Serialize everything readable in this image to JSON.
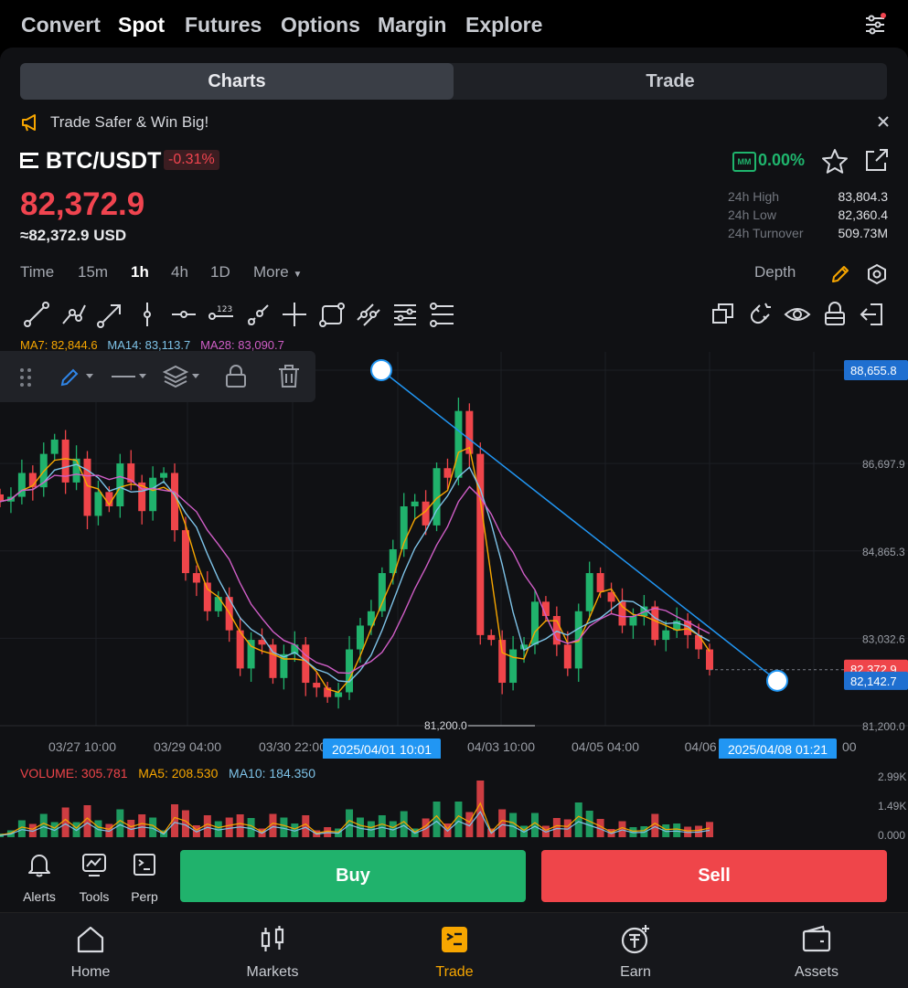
{
  "top_nav": [
    "Convert",
    "Spot",
    "Futures",
    "Options",
    "Margin",
    "Explore"
  ],
  "top_nav_active": "Spot",
  "segment": {
    "charts": "Charts",
    "trade": "Trade"
  },
  "promo": {
    "text": "Trade Safer & Win Big!"
  },
  "pair": {
    "symbol": "BTC/USDT",
    "change": "-0.31%",
    "price": "82,372.9",
    "usd": "≈82,372.9 USD"
  },
  "mm": {
    "badge": "MM",
    "value": "0.00%"
  },
  "stats": [
    {
      "label": "24h High",
      "value": "83,804.3"
    },
    {
      "label": "24h Low",
      "value": "82,360.4"
    },
    {
      "label": "24h Turnover",
      "value": "509.73M"
    }
  ],
  "timeframes": {
    "time": "Time",
    "m15": "15m",
    "h1": "1h",
    "h4": "4h",
    "d1": "1D",
    "more": "More",
    "depth": "Depth"
  },
  "ma_legend": {
    "ma7": "MA7: 82,844.6",
    "ma14": "MA14: 83,113.7",
    "ma28": "MA28: 83,090.7"
  },
  "colors": {
    "ma7": "#f7a600",
    "ma14": "#7ec3e8",
    "ma28": "#d05ec7",
    "up": "#20b26c",
    "down": "#ef454a",
    "accent": "#2196f3"
  },
  "chart_data": {
    "type": "candlestick",
    "pair": "BTC/USDT",
    "interval": "1h",
    "y_ticks": [
      "88,655.8",
      "86,697.9",
      "84,865.3",
      "83,032.6",
      "81,200.0"
    ],
    "ylim": [
      81200.0,
      88655.8
    ],
    "x_ticks": [
      "03/27 10:00",
      "03/29 04:00",
      "03/30 22:00",
      "04/03 10:00",
      "04/05 04:00",
      "04/06 2"
    ],
    "x_ticks_tail": "00",
    "last_price_tag": "82,372.9",
    "trendline_end_tag": "82,142.7",
    "low_marker": "81,200.0",
    "crosshair_x_labels": [
      "2025/04/01 10:01",
      "2025/04/08 01:21"
    ],
    "closes": [
      85900,
      86000,
      86500,
      86200,
      86900,
      87200,
      86300,
      86800,
      85600,
      86100,
      85800,
      86700,
      86300,
      85700,
      86400,
      86500,
      85300,
      84400,
      84200,
      83600,
      83900,
      83200,
      82400,
      83000,
      82900,
      82200,
      82700,
      82900,
      82100,
      82000,
      81800,
      81900,
      82800,
      83300,
      83600,
      84400,
      84900,
      85800,
      85900,
      85400,
      86600,
      86400,
      87800,
      86900,
      83100,
      83000,
      82100,
      82800,
      82900,
      83800,
      83500,
      82900,
      82400,
      83600,
      84400,
      84000,
      83800,
      83300,
      83500,
      83700,
      83000,
      83200,
      83400,
      83100,
      82800,
      82373
    ],
    "volume": {
      "label": "VOLUME: 305.781",
      "ma5": "MA5: 208.530",
      "ma10": "MA10: 184.350",
      "y_ticks": [
        "2.99K",
        "1.49K",
        "0.000"
      ]
    }
  },
  "actions": [
    {
      "label": "Alerts"
    },
    {
      "label": "Tools"
    },
    {
      "label": "Perp"
    }
  ],
  "buy_label": "Buy",
  "sell_label": "Sell",
  "bottom_nav": [
    "Home",
    "Markets",
    "Trade",
    "Earn",
    "Assets"
  ],
  "bottom_nav_active": "Trade"
}
